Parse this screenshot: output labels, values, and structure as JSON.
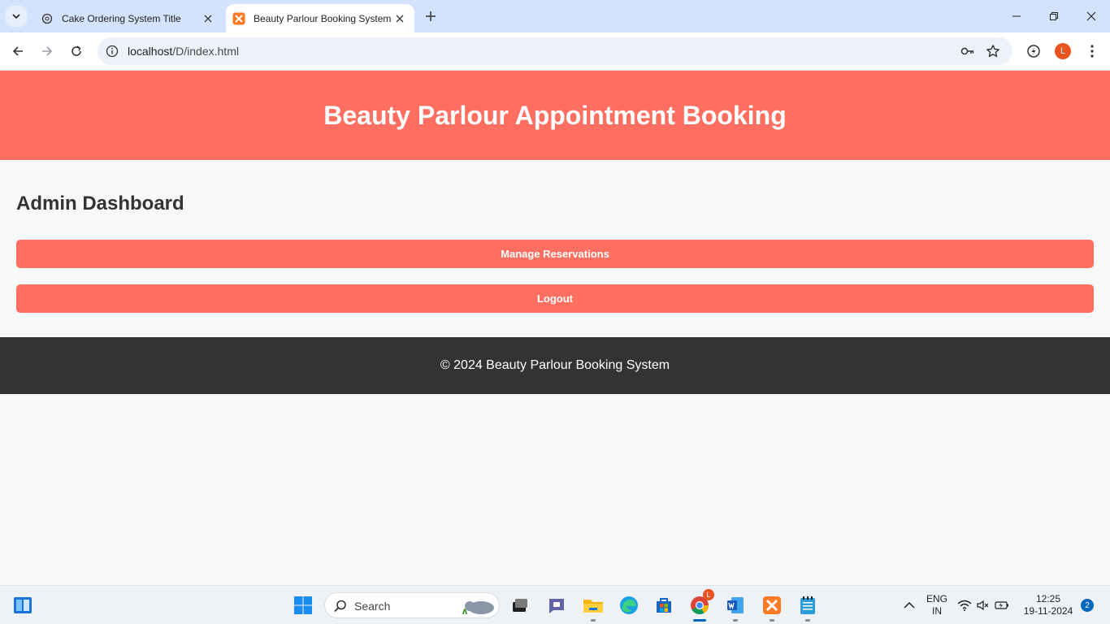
{
  "browser": {
    "tabs": [
      {
        "title": "Cake Ordering System Title",
        "active": false
      },
      {
        "title": "Beauty Parlour Booking System",
        "active": true
      }
    ],
    "url_host": "localhost",
    "url_path": "/D/index.html",
    "profile_initial": "L"
  },
  "page": {
    "header_title": "Beauty Parlour Appointment Booking",
    "section_title": "Admin Dashboard",
    "buttons": {
      "manage": "Manage Reservations",
      "logout": "Logout"
    },
    "footer": "© 2024 Beauty Parlour Booking System",
    "colors": {
      "accent": "#ff6f61",
      "footer": "#333333"
    }
  },
  "taskbar": {
    "search_placeholder": "Search",
    "chrome_badge": "L",
    "lang_line1": "ENG",
    "lang_line2": "IN",
    "time": "12:25",
    "date": "19-11-2024",
    "notification_count": "2"
  }
}
